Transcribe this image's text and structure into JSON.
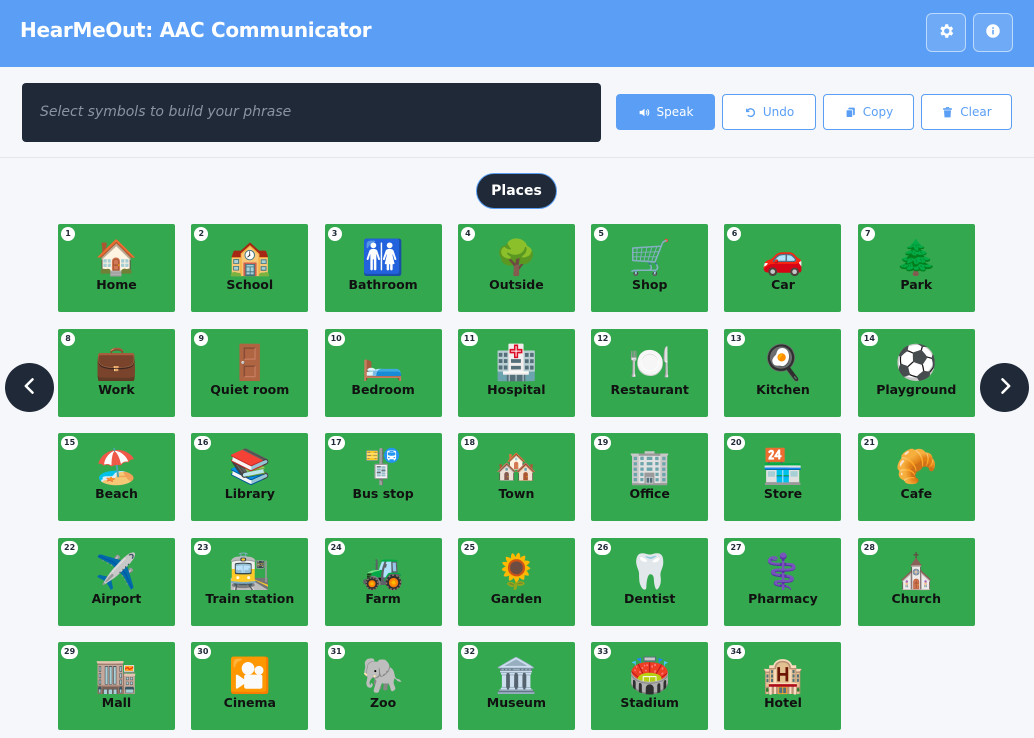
{
  "app": {
    "title": "HearMeOut: AAC Communicator",
    "settings_icon": "gear-icon",
    "info_icon": "info-icon"
  },
  "phrase": {
    "placeholder": "Select symbols to build your phrase"
  },
  "actions": {
    "speak": "Speak",
    "undo": "Undo",
    "copy": "Copy",
    "clear": "Clear"
  },
  "category": "Places",
  "colors": {
    "header": "#5a9ff5",
    "tile": "#34a84f",
    "dark": "#1f2937"
  },
  "tiles": [
    {
      "num": "1",
      "emoji": "🏠",
      "label": "Home"
    },
    {
      "num": "2",
      "emoji": "🏫",
      "label": "School"
    },
    {
      "num": "3",
      "emoji": "🚻",
      "label": "Bathroom"
    },
    {
      "num": "4",
      "emoji": "🌳",
      "label": "Outside"
    },
    {
      "num": "5",
      "emoji": "🛒",
      "label": "Shop"
    },
    {
      "num": "6",
      "emoji": "🚗",
      "label": "Car"
    },
    {
      "num": "7",
      "emoji": "🌲",
      "label": "Park"
    },
    {
      "num": "8",
      "emoji": "💼",
      "label": "Work"
    },
    {
      "num": "9",
      "emoji": "🚪",
      "label": "Quiet room"
    },
    {
      "num": "10",
      "emoji": "🛏️",
      "label": "Bedroom"
    },
    {
      "num": "11",
      "emoji": "🏥",
      "label": "Hospital"
    },
    {
      "num": "12",
      "emoji": "🍽️",
      "label": "Restaurant"
    },
    {
      "num": "13",
      "emoji": "🍳",
      "label": "Kitchen"
    },
    {
      "num": "14",
      "emoji": "⚽",
      "label": "Playground"
    },
    {
      "num": "15",
      "emoji": "🏖️",
      "label": "Beach"
    },
    {
      "num": "16",
      "emoji": "📚",
      "label": "Library"
    },
    {
      "num": "17",
      "emoji": "🚏",
      "label": "Bus stop"
    },
    {
      "num": "18",
      "emoji": "🏘️",
      "label": "Town"
    },
    {
      "num": "19",
      "emoji": "🏢",
      "label": "Office"
    },
    {
      "num": "20",
      "emoji": "🏪",
      "label": "Store"
    },
    {
      "num": "21",
      "emoji": "🥐",
      "label": "Cafe"
    },
    {
      "num": "22",
      "emoji": "✈️",
      "label": "Airport"
    },
    {
      "num": "23",
      "emoji": "🚉",
      "label": "Train station"
    },
    {
      "num": "24",
      "emoji": "🚜",
      "label": "Farm"
    },
    {
      "num": "25",
      "emoji": "🌻",
      "label": "Garden"
    },
    {
      "num": "26",
      "emoji": "🦷",
      "label": "Dentist"
    },
    {
      "num": "27",
      "emoji": "⚕️",
      "label": "Pharmacy"
    },
    {
      "num": "28",
      "emoji": "⛪",
      "label": "Church"
    },
    {
      "num": "29",
      "emoji": "🏬",
      "label": "Mall"
    },
    {
      "num": "30",
      "emoji": "🎦",
      "label": "Cinema"
    },
    {
      "num": "31",
      "emoji": "🐘",
      "label": "Zoo"
    },
    {
      "num": "32",
      "emoji": "🏛️",
      "label": "Museum"
    },
    {
      "num": "33",
      "emoji": "🏟️",
      "label": "Stadium"
    },
    {
      "num": "34",
      "emoji": "🏨",
      "label": "Hotel"
    }
  ]
}
